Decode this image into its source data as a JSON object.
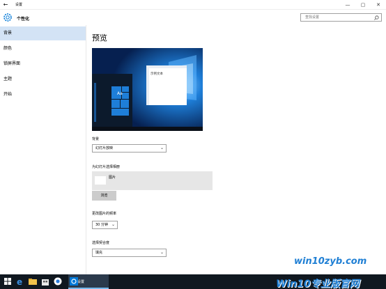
{
  "window": {
    "title": "设置",
    "controls": [
      "—",
      "▢",
      "✕"
    ]
  },
  "header": {
    "title": "个性化",
    "icon": "gear-icon",
    "search_placeholder": "查找设置"
  },
  "sidebar": {
    "items": [
      {
        "label": "背景",
        "active": true
      },
      {
        "label": "颜色",
        "active": false
      },
      {
        "label": "锁屏界面",
        "active": false
      },
      {
        "label": "主题",
        "active": false
      },
      {
        "label": "开始",
        "active": false
      }
    ]
  },
  "main": {
    "preview_heading": "预览",
    "preview_sample_text": "示例文本",
    "preview_tile_text": "Aa",
    "background_label": "背景",
    "background_value": "幻灯片放映",
    "album_label": "为幻灯片选择相册",
    "album_item": "图片",
    "browse_button": "浏览",
    "frequency_label": "更改图片的频率",
    "frequency_value": "30 分钟",
    "fit_label": "选择契合度",
    "fit_value": "填充"
  },
  "taskbar": {
    "active_app": "设置",
    "icons": [
      "windows-icon",
      "search-icon",
      "task-view-icon",
      "edge-icon",
      "file-explorer-icon",
      "store-icon",
      "chrome-icon",
      "settings-icon"
    ]
  },
  "watermark": {
    "line1": "win10zyb.com",
    "line2": "Win10专业版官网"
  },
  "colors": {
    "accent": "#0078d7",
    "sidebar_active": "#d3e3f5",
    "taskbar": "#101820",
    "watermark": "#1f7fd4"
  }
}
